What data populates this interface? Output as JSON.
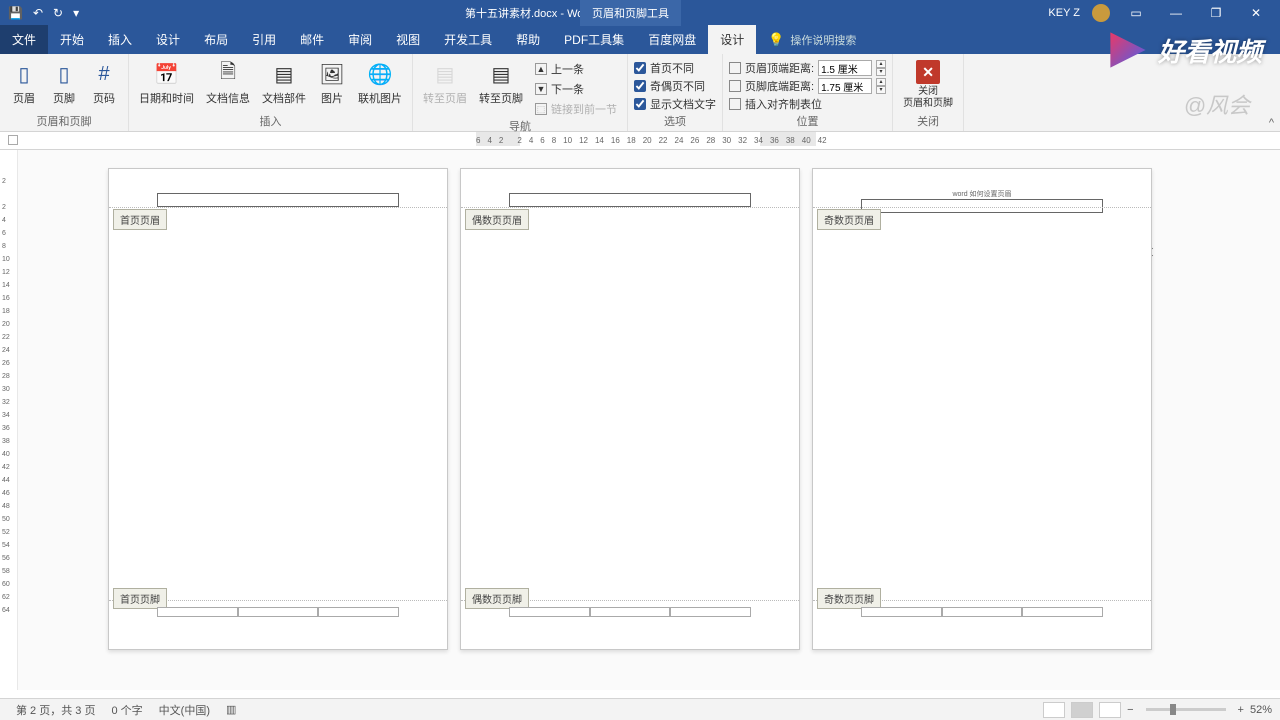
{
  "title": "第十五讲素材.docx - Word",
  "context_tab": "页眉和页脚工具",
  "user": "KEY Z",
  "qat": {
    "save": "💾",
    "undo": "↶",
    "redo": "↻",
    "more": "▾"
  },
  "win": {
    "opts": "▭",
    "min": "—",
    "max": "❐",
    "close": "✕"
  },
  "tabs": {
    "file": "文件",
    "home": "开始",
    "insert": "插入",
    "design": "设计",
    "layout": "布局",
    "ref": "引用",
    "mail": "邮件",
    "review": "审阅",
    "view": "视图",
    "dev": "开发工具",
    "help": "帮助",
    "pdf": "PDF工具集",
    "baidu": "百度网盘",
    "hf_design": "设计",
    "tellme": "操作说明搜索"
  },
  "ribbon": {
    "g1": {
      "label": "页眉和页脚",
      "header": "页眉",
      "footer": "页脚",
      "pagenum": "页码"
    },
    "g2": {
      "label": "插入",
      "datetime": "日期和时间",
      "docinfo": "文档信息",
      "quickparts": "文档部件",
      "picture": "图片",
      "online_pic": "联机图片"
    },
    "g3": {
      "label": "导航",
      "goto_header": "转至页眉",
      "goto_footer": "转至页脚",
      "prev": "上一条",
      "next": "下一条",
      "link": "链接到前一节"
    },
    "g4": {
      "label": "选项",
      "diff_first": "首页不同",
      "diff_oe": "奇偶页不同",
      "show_doc": "显示文档文字"
    },
    "g5": {
      "label": "位置",
      "header_dist": "页眉顶端距离:",
      "header_val": "1.5 厘米",
      "footer_dist": "页脚底端距离:",
      "footer_val": "1.75 厘米",
      "insert_tab": "插入对齐制表位"
    },
    "g6": {
      "label": "关闭",
      "close1": "关闭",
      "close2": "页眉和页脚"
    }
  },
  "ruler_h": [
    "6",
    "4",
    "2",
    "",
    "2",
    "4",
    "6",
    "8",
    "10",
    "12",
    "14",
    "16",
    "18",
    "20",
    "22",
    "24",
    "26",
    "28",
    "30",
    "32",
    "34",
    "36",
    "38",
    "40",
    "42"
  ],
  "ruler_v": [
    "2",
    "",
    "2",
    "4",
    "6",
    "8",
    "10",
    "12",
    "14",
    "16",
    "18",
    "20",
    "22",
    "24",
    "26",
    "28",
    "30",
    "32",
    "34",
    "36",
    "38",
    "40",
    "42",
    "44",
    "46",
    "48",
    "50",
    "52",
    "54",
    "56",
    "58",
    "60",
    "62",
    "64"
  ],
  "pages": {
    "p1": {
      "hdr": "首页页眉",
      "ftr": "首页页脚"
    },
    "p2": {
      "hdr": "偶数页页眉",
      "ftr": "偶数页页脚"
    },
    "p3": {
      "hdr": "奇数页页眉",
      "ftr": "奇数页页脚",
      "tiny": "word 如何设置页眉"
    }
  },
  "status": {
    "page": "第 2 页，共 3 页",
    "words": "0 个字",
    "lang": "中文(中国)",
    "zoom": "52%"
  },
  "watermark": {
    "brand": "好看视频",
    "author": "@风会"
  }
}
